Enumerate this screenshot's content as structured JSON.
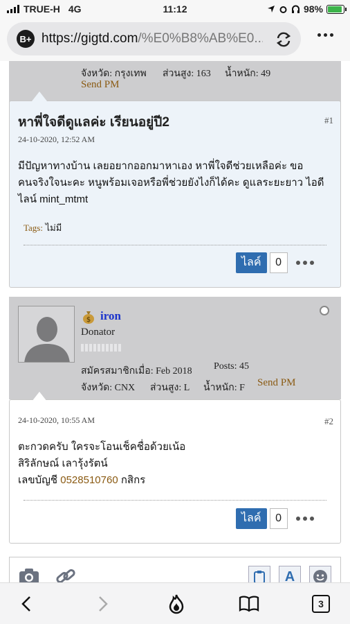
{
  "status_bar": {
    "carrier": "TRUE-H",
    "network": "4G",
    "time": "11:12",
    "battery": "98%"
  },
  "url_bar": {
    "badge": "B+",
    "url_host": "https://gigtd.com",
    "url_path": "/%E0%B8%AB%E0..."
  },
  "previous_post_tail": {
    "province_label": "จังหวัด: กรุงเทพ",
    "height_label": "ส่วนสูง: 163",
    "weight_label": "น้ำหนัก: 49",
    "send_pm": "Send PM"
  },
  "post1": {
    "title": "หาพี่ใจดีดูแลค่ะ เรียนอยู่ปี2",
    "date": "24-10-2020, 12:52 AM",
    "number": "#1",
    "body": "มีปัญหาทางบ้าน เลยอยากออกมาหาเอง หาพี่ใจดีช่วยเหลือค่ะ ขอคนจริงใจนะคะ หนูพร้อมเจอหรือพี่ช่วยยังไงก็ได้คะ ดูแลระยะยาว ไอดีไลน์ mint_mtmt",
    "tags_label": "Tags:",
    "tags_value": "ไม่มี",
    "like_label": "ไลค์",
    "like_count": "0"
  },
  "post2_author": {
    "username": "iron",
    "role": "Donator",
    "joined": "สมัครสมาชิกเมื่อ: Feb 2018",
    "posts": "Posts: 45",
    "province": "จังหวัด: CNX",
    "height": "ส่วนสูง: L",
    "weight": "น้ำหนัก: F",
    "send_pm": "Send PM"
  },
  "post2": {
    "date": "24-10-2020, 10:55 AM",
    "number": "#2",
    "line1": "ตะกวดครับ ใครจะโอนเช็คชื่อด้วยเน้อ",
    "line2": "สิริลักษณ์ เลารุ้งรัตน์",
    "line3_prefix": "เลขบัญชี",
    "account_number": "0528510760",
    "line3_suffix": "กสิกร",
    "like_label": "ไลค์",
    "like_count": "0"
  },
  "bottom_nav": {
    "tab_count": "3"
  },
  "colors": {
    "header_gray": "#cdcdcf",
    "post1_bg": "#edf3f9",
    "accent_blue": "#2f6db0",
    "link_brown": "#8a5a12",
    "username_blue": "#1a33cc"
  }
}
